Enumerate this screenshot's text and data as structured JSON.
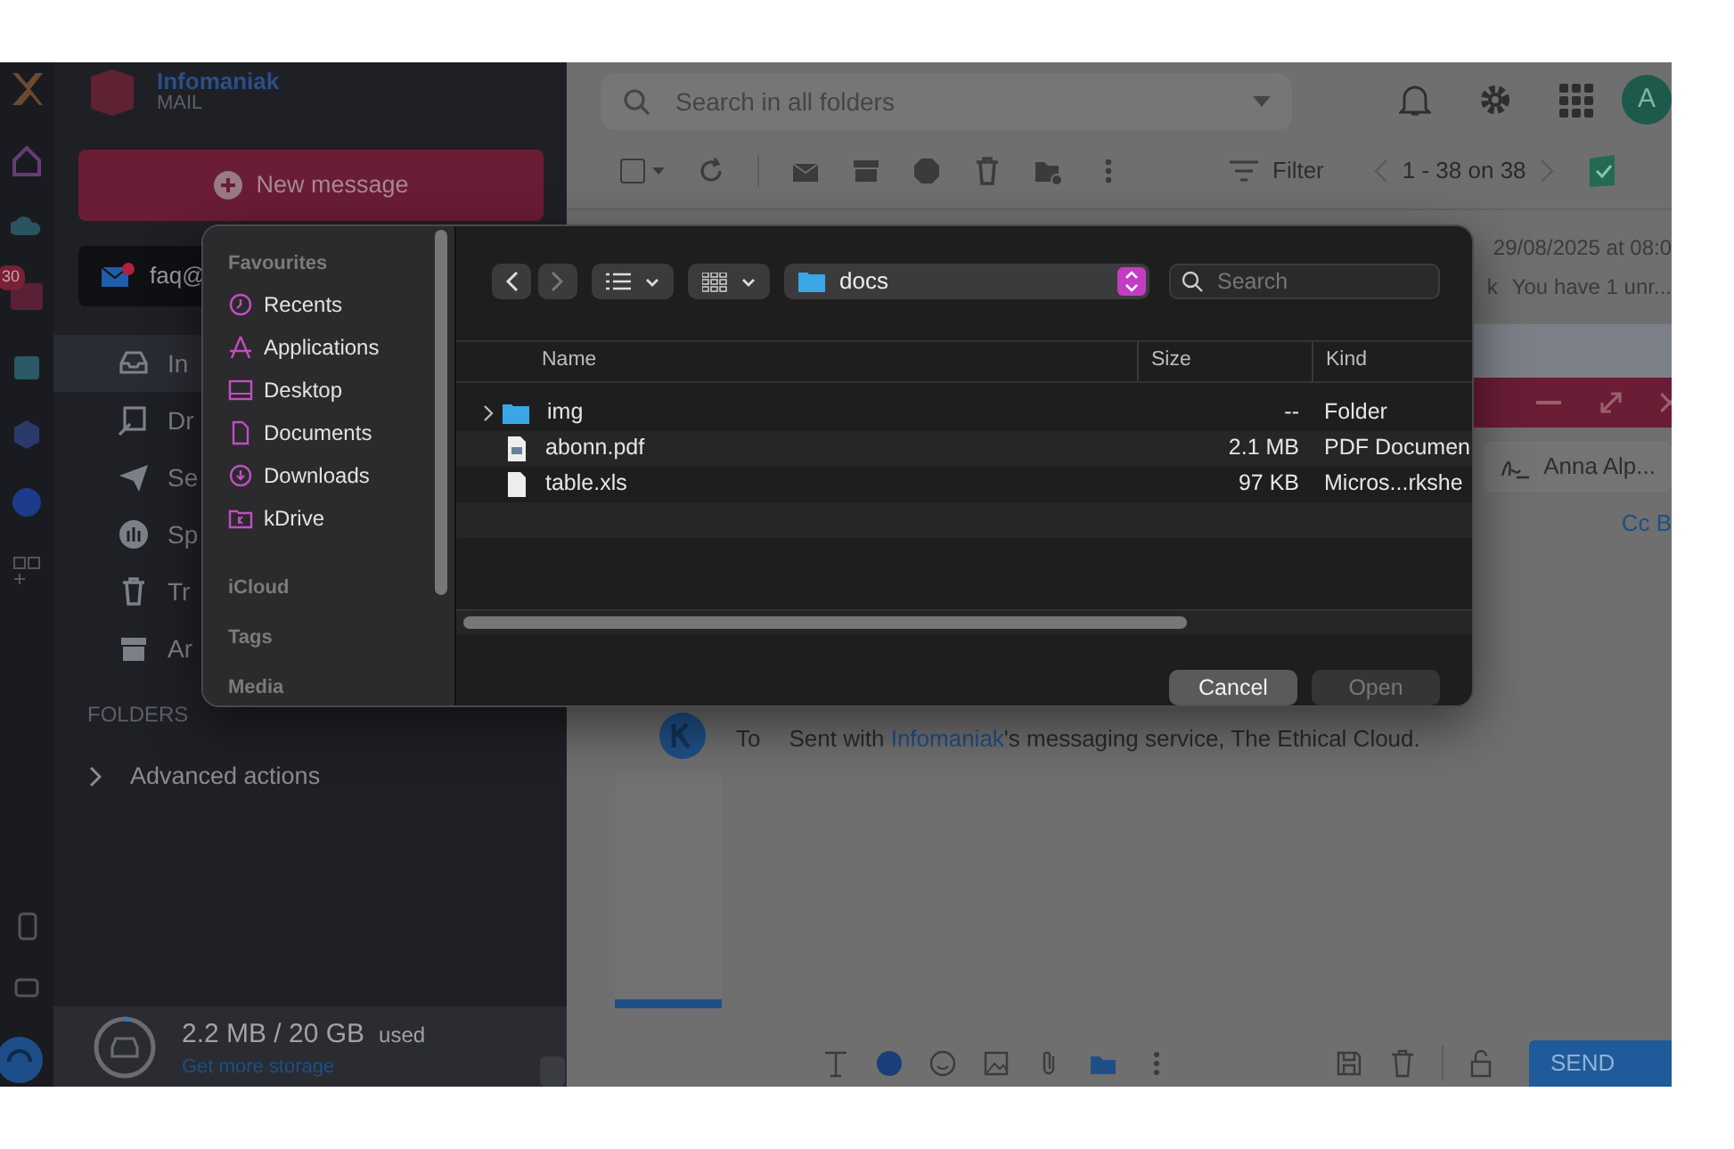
{
  "rail": {
    "badge": "30"
  },
  "brand": {
    "name": "Infomaniak",
    "product": "MAIL"
  },
  "new_message": "New message",
  "account": "faq@",
  "folders": [
    {
      "label": "In",
      "selected": true
    },
    {
      "label": "Dr",
      "selected": false
    },
    {
      "label": "Se",
      "selected": false
    },
    {
      "label": "Sp",
      "selected": false
    },
    {
      "label": "Tr",
      "selected": false
    },
    {
      "label": "Ar",
      "selected": false
    }
  ],
  "folders_heading": "FOLDERS",
  "advanced_actions": "Advanced actions",
  "storage": {
    "used": "2.2 MB / 20 GB",
    "suffix": "used",
    "link": "Get more storage",
    "level": 0.03
  },
  "search": {
    "placeholder": "Search in all folders"
  },
  "avatar": "A",
  "toolbar": {
    "select_all_checked": false,
    "filter": "Filter",
    "pager": "1 - 38 on 38"
  },
  "messages": [
    {
      "date": "29/08/2025 at 08:0",
      "sender": "k",
      "preview": "You have 1 unr...",
      "selected": false
    },
    {
      "selected": true
    }
  ],
  "compose": {
    "recipient": "Anna Alp...",
    "cc": "Cc B",
    "to_label": "To",
    "signature": [
      "Sent with ",
      "Infomaniak",
      "'s messaging service, The Ethical Cloud."
    ],
    "send": "SEND"
  },
  "dialog": {
    "sidebar": [
      {
        "kind": "heading",
        "label": "Favourites"
      },
      {
        "kind": "item",
        "label": "Recents"
      },
      {
        "kind": "item",
        "label": "Applications"
      },
      {
        "kind": "item",
        "label": "Desktop"
      },
      {
        "kind": "item",
        "label": "Documents"
      },
      {
        "kind": "item",
        "label": "Downloads"
      },
      {
        "kind": "item",
        "label": "kDrive"
      },
      {
        "kind": "heading",
        "label": "iCloud"
      },
      {
        "kind": "heading",
        "label": "Tags"
      },
      {
        "kind": "heading",
        "label": "Media"
      }
    ],
    "path": "docs",
    "search_placeholder": "Search",
    "columns": [
      "Name",
      "Size",
      "Kind"
    ],
    "files": [
      {
        "kind": "folder",
        "name": "img",
        "size": "--",
        "type": "Folder"
      },
      {
        "kind": "pdf",
        "name": "abonn.pdf",
        "size": "2.1 MB",
        "type": "PDF Documen"
      },
      {
        "kind": "file",
        "name": "table.xls",
        "size": "97 KB",
        "type": "Micros...rkshe"
      }
    ],
    "buttons": [
      {
        "label": "Cancel",
        "disabled": false
      },
      {
        "label": "Open",
        "disabled": true
      }
    ]
  }
}
